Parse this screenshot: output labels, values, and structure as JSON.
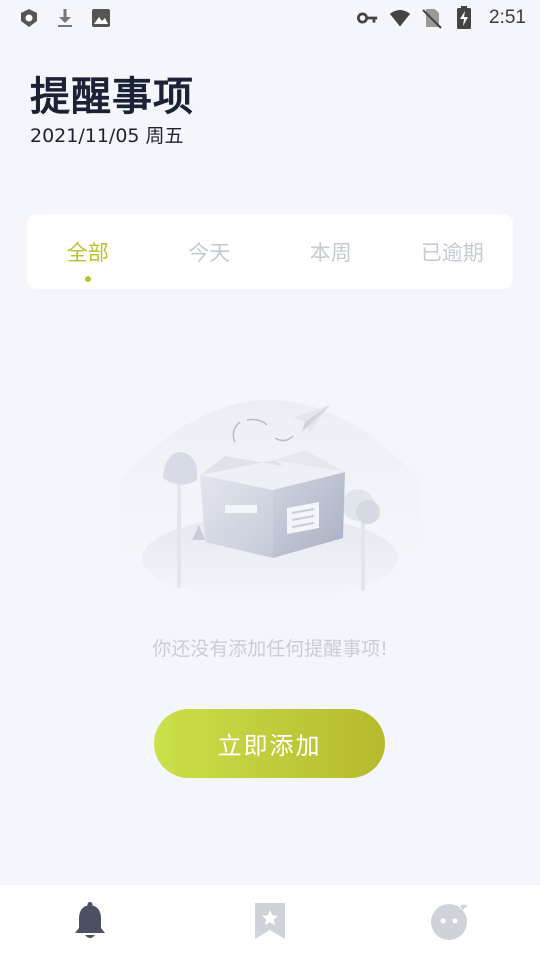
{
  "status_bar": {
    "time": "2:51",
    "left_icons": [
      "app-notification-icon",
      "download-icon",
      "image-icon"
    ],
    "right_icons": [
      "key-icon",
      "wifi-icon",
      "no-sim-icon",
      "battery-charging-icon"
    ]
  },
  "header": {
    "title": "提醒事项",
    "date": "2021/11/05 周五"
  },
  "tabs": [
    {
      "label": "全部",
      "active": true
    },
    {
      "label": "今天",
      "active": false
    },
    {
      "label": "本周",
      "active": false
    },
    {
      "label": "已逾期",
      "active": false
    }
  ],
  "empty_state": {
    "illustration": "empty-box-illustration",
    "message": "你还没有添加任何提醒事项!"
  },
  "add_button": {
    "label": "立即添加"
  },
  "bottom_nav": [
    {
      "icon": "bell-icon",
      "active": true
    },
    {
      "icon": "bookmark-star-icon",
      "active": false
    },
    {
      "icon": "profile-face-icon",
      "active": false
    }
  ],
  "colors": {
    "accent": "#b9c22c",
    "button_gradient_start": "#cbe04b",
    "button_gradient_end": "#b5ba2c",
    "background": "#f4f6fb",
    "inactive_tab": "#c6cad3",
    "nav_active": "#4b5064",
    "nav_inactive": "#cfd2d9"
  }
}
